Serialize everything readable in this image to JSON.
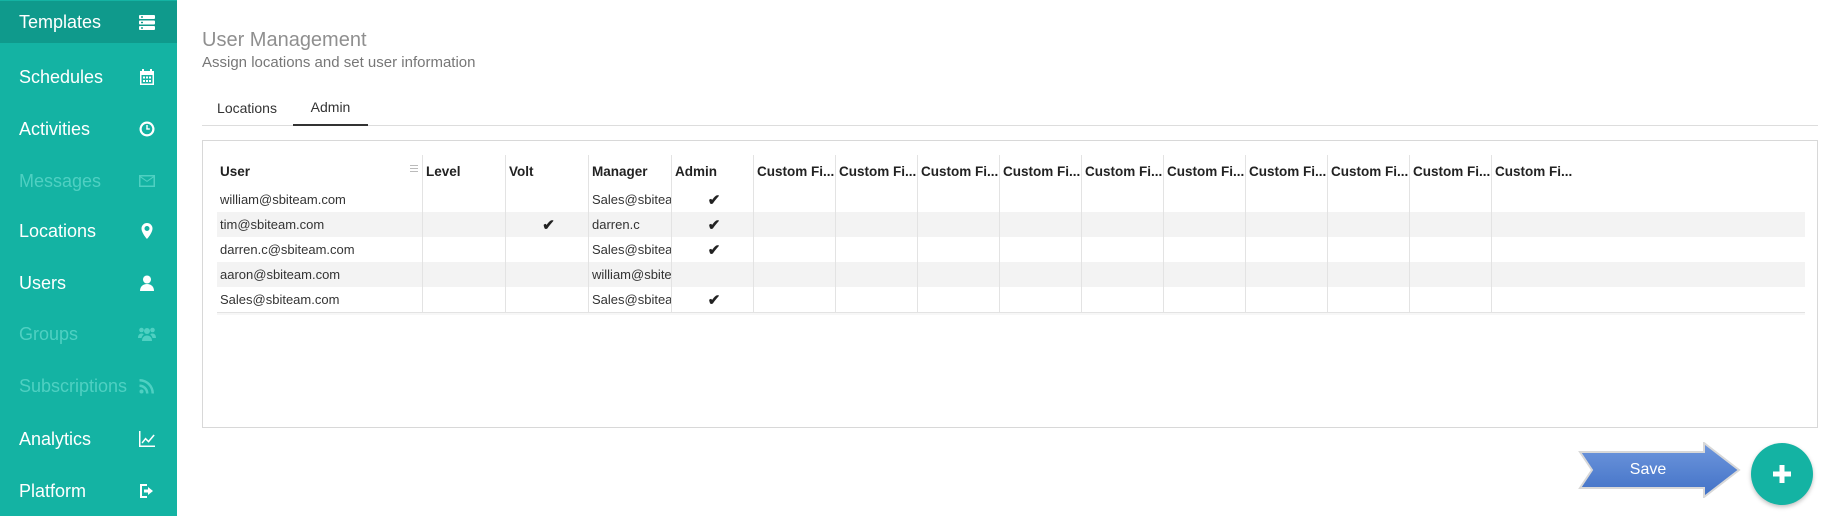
{
  "sidebar": {
    "items": [
      {
        "label": "Templates",
        "icon": "server-icon"
      },
      {
        "label": "Schedules",
        "icon": "calendar-icon"
      },
      {
        "label": "Activities",
        "icon": "clock-icon"
      },
      {
        "label": "Messages",
        "icon": "envelope-icon"
      },
      {
        "label": "Locations",
        "icon": "map-pin-icon"
      },
      {
        "label": "Users",
        "icon": "user-icon"
      },
      {
        "label": "Groups",
        "icon": "users-group-icon"
      },
      {
        "label": "Subscriptions",
        "icon": "rss-icon"
      },
      {
        "label": "Analytics",
        "icon": "line-chart-icon"
      },
      {
        "label": "Platform",
        "icon": "sign-out-icon"
      }
    ]
  },
  "header": {
    "title": "User Management",
    "subtitle": "Assign locations and set user information"
  },
  "tabs": [
    {
      "label": "Locations"
    },
    {
      "label": "Admin"
    }
  ],
  "grid": {
    "columns": [
      "User",
      "Level",
      "Volt",
      "Manager",
      "Admin",
      "Custom Fi...",
      "Custom Fi...",
      "Custom Fi...",
      "Custom Fi...",
      "Custom Fi...",
      "Custom Fi...",
      "Custom Fi...",
      "Custom Fi...",
      "Custom Fi...",
      "Custom Fi..."
    ],
    "rows": [
      {
        "user": "william@sbiteam.com",
        "level": "",
        "volt": "",
        "manager": "Sales@sbiteam",
        "admin": "✔"
      },
      {
        "user": "tim@sbiteam.com",
        "level": "",
        "volt": "✔",
        "manager": "darren.c",
        "admin": "✔"
      },
      {
        "user": "darren.c@sbiteam.com",
        "level": "",
        "volt": "",
        "manager": "Sales@sbiteam",
        "admin": "✔"
      },
      {
        "user": "aaron@sbiteam.com",
        "level": "",
        "volt": "",
        "manager": "william@sbitea",
        "admin": ""
      },
      {
        "user": "Sales@sbiteam.com",
        "level": "",
        "volt": "",
        "manager": "Sales@sbiteam",
        "admin": "✔"
      }
    ]
  },
  "actions": {
    "save_label": "Save",
    "add_icon": "plus-icon"
  },
  "colors": {
    "sidebar": "#14b3a3",
    "sidebar_active": "#0f9a8c",
    "save_arrow": "#4f7fd4",
    "fab": "#14b3a3"
  }
}
